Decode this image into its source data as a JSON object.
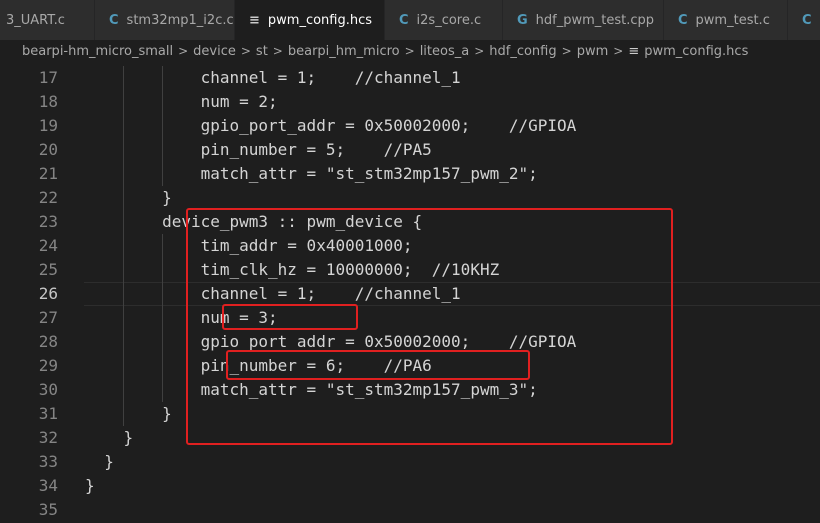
{
  "tabs": [
    {
      "icon": "",
      "label": "3_UART.c",
      "active": false
    },
    {
      "icon": "C",
      "label": "stm32mp1_i2c.c",
      "active": false
    },
    {
      "icon": "≡",
      "label": "pwm_config.hcs",
      "active": true,
      "close": "✕"
    },
    {
      "icon": "C",
      "label": "i2s_core.c",
      "active": false
    },
    {
      "icon": "G",
      "label": "hdf_pwm_test.cpp",
      "active": false
    },
    {
      "icon": "C",
      "label": "pwm_test.c",
      "active": false
    },
    {
      "icon": "C",
      "label": "",
      "active": false
    }
  ],
  "breadcrumb": {
    "items": [
      "bearpi-hm_micro_small",
      "device",
      "st",
      "bearpi_hm_micro",
      "liteos_a",
      "hdf_config",
      "pwm"
    ],
    "separator": ">",
    "file_icon": "≡",
    "file": "pwm_config.hcs"
  },
  "editor": {
    "current_line": 26,
    "lines": [
      {
        "n": "17",
        "text": "            channel = 1;    //channel_1"
      },
      {
        "n": "18",
        "text": "            num = 2;"
      },
      {
        "n": "19",
        "text": "            gpio_port_addr = 0x50002000;    //GPIOA"
      },
      {
        "n": "20",
        "text": "            pin_number = 5;    //PA5"
      },
      {
        "n": "21",
        "text": "            match_attr = \"st_stm32mp157_pwm_2\";"
      },
      {
        "n": "22",
        "text": "        }"
      },
      {
        "n": "23",
        "text": "        device_pwm3 :: pwm_device {"
      },
      {
        "n": "24",
        "text": "            tim_addr = 0x40001000;"
      },
      {
        "n": "25",
        "text": "            tim_clk_hz = 10000000;  //10KHZ"
      },
      {
        "n": "26",
        "text": "            channel = 1;    //channel_1"
      },
      {
        "n": "27",
        "text": "            num = 3;"
      },
      {
        "n": "28",
        "text": "            gpio_port_addr = 0x50002000;    //GPIOA"
      },
      {
        "n": "29",
        "text": "            pin_number = 6;    //PA6"
      },
      {
        "n": "30",
        "text": "            match_attr = \"st_stm32mp157_pwm_3\";"
      },
      {
        "n": "31",
        "text": "        }"
      },
      {
        "n": "32",
        "text": "    }"
      },
      {
        "n": "33",
        "text": "  }"
      },
      {
        "n": "34",
        "text": "}"
      },
      {
        "n": "35",
        "text": ""
      }
    ]
  },
  "colors": {
    "annotation": "#e02020",
    "background": "#1e1e1e",
    "tab_bar": "#252526"
  }
}
